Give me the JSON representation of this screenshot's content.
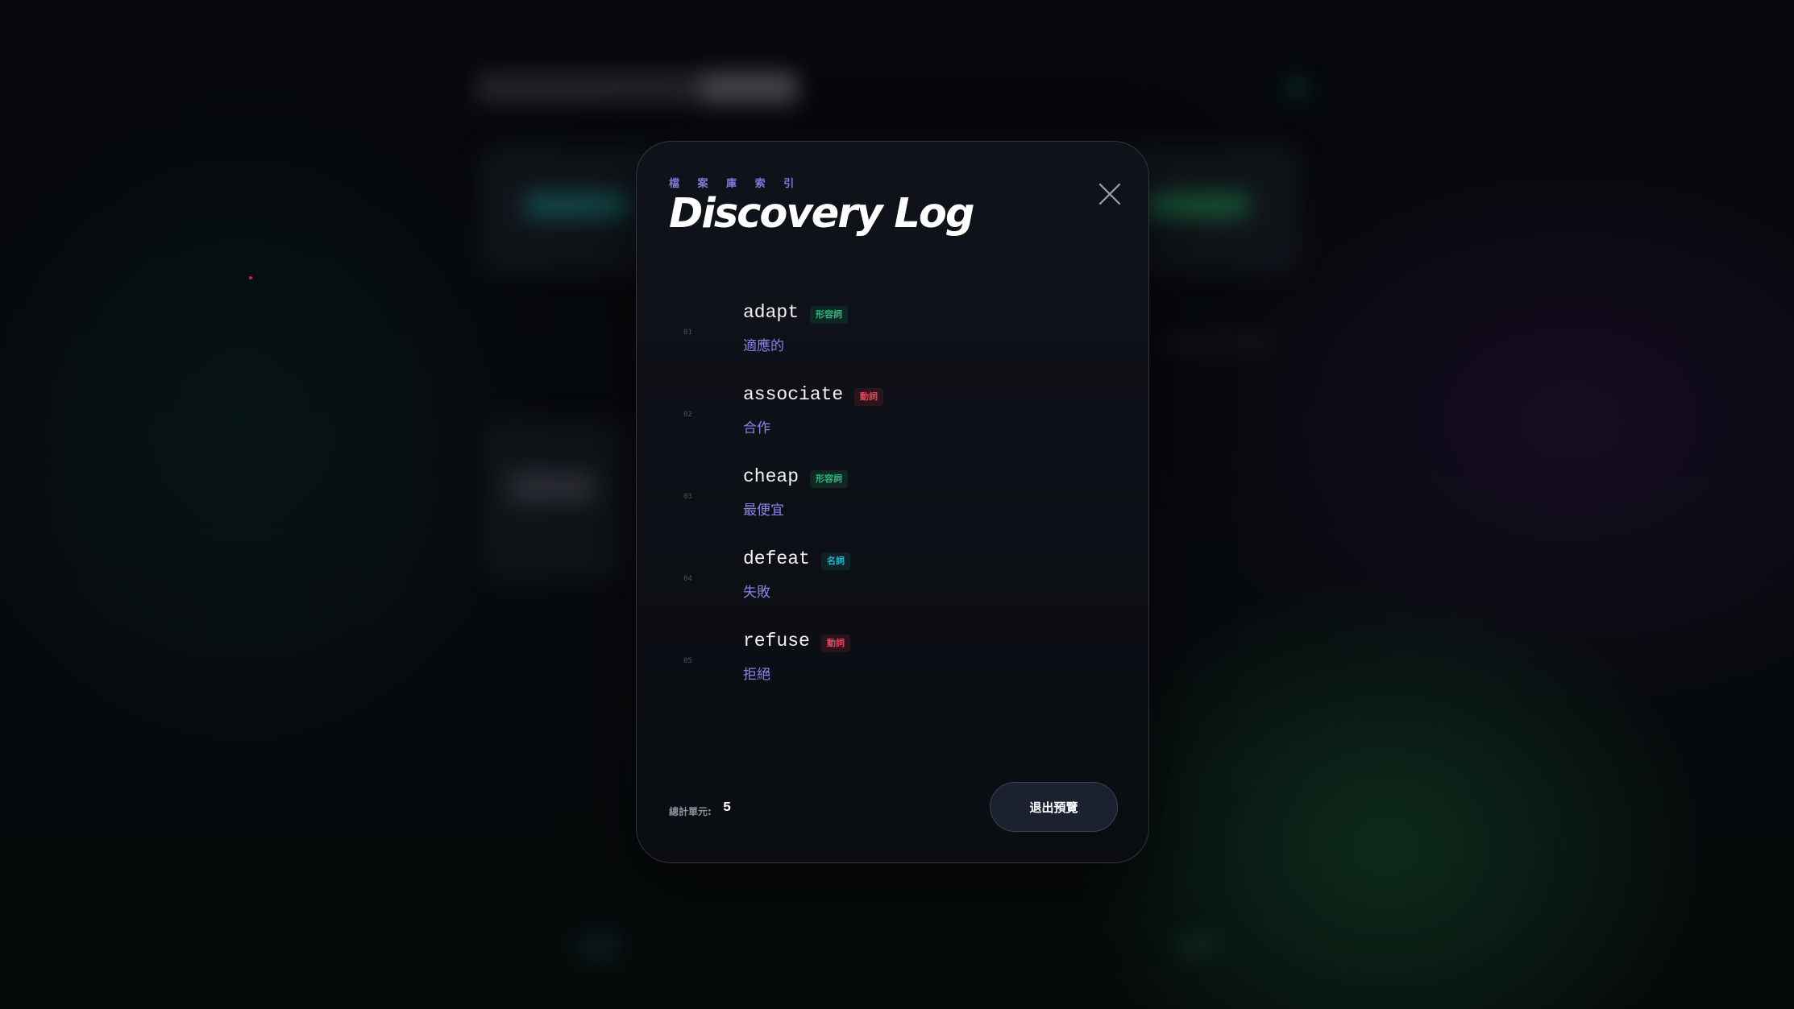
{
  "modal": {
    "kicker": "檔 案 庫 索 引",
    "title": "Discovery Log",
    "close_icon": "close-icon",
    "tag_colors": {
      "green": "#2fb67f",
      "red": "#e0455b",
      "cyan": "#23b7c9",
      "meaning": "#8784e8"
    },
    "entries": [
      {
        "num": "01",
        "word": "adapt",
        "pos": "形容詞",
        "pos_color": "green",
        "meaning": "適應的"
      },
      {
        "num": "02",
        "word": "associate",
        "pos": "動詞",
        "pos_color": "red",
        "meaning": "合作"
      },
      {
        "num": "03",
        "word": "cheap",
        "pos": "形容詞",
        "pos_color": "green",
        "meaning": "最便宜"
      },
      {
        "num": "04",
        "word": "defeat",
        "pos": "名詞",
        "pos_color": "cyan",
        "meaning": "失敗"
      },
      {
        "num": "05",
        "word": "refuse",
        "pos": "動詞",
        "pos_color": "red",
        "meaning": "拒絕"
      }
    ],
    "footer": {
      "total_label": "總計單元:",
      "total_count": "5",
      "exit_label": "退出預覽"
    }
  }
}
